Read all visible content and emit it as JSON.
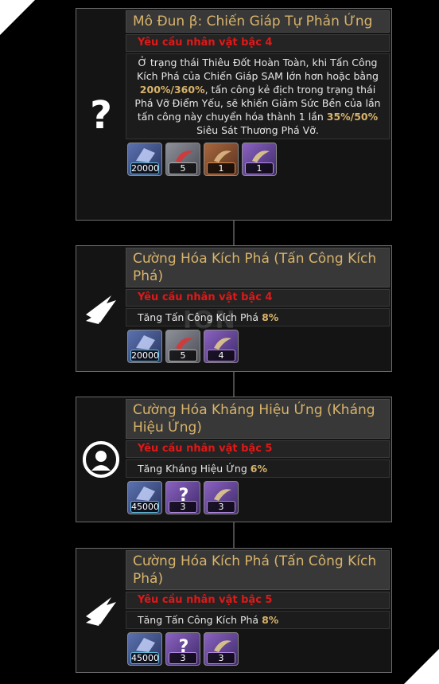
{
  "cards": [
    {
      "icon": "question-icon",
      "title": "Mô Đun β: Chiến Giáp Tự Phản Ứng",
      "requirement": "Yêu cầu nhân vật bậc 4",
      "desc_parts": [
        "Ở trạng thái Thiêu Đốt Hoàn Toàn, khi Tấn Công Kích Phá của Chiến Giáp SAM lớn hơn hoặc bằng ",
        "200%/360%",
        ", tấn công kẻ địch trong trạng thái Phá Vỡ Điểm Yếu, sẽ khiến Giảm Sức Bền của lần tấn công này chuyển hóa thành 1 lần ",
        "35%/50%",
        " Siêu Sát Thương Phá Vỡ."
      ],
      "items": [
        {
          "icon": "credit-crystal-icon",
          "qty": "20000",
          "rarity": "blue"
        },
        {
          "icon": "claw-material-icon",
          "qty": "5",
          "rarity": "gray"
        },
        {
          "icon": "claw-material-icon",
          "qty": "1",
          "rarity": "orange"
        },
        {
          "icon": "claw-material-icon",
          "qty": "1",
          "rarity": "purple"
        }
      ]
    },
    {
      "icon": "break-claw-icon",
      "title": "Cường Hóa Kích Phá (Tấn Công Kích Phá)",
      "requirement": "Yêu cầu nhân vật bậc 4",
      "desc_text": "Tăng Tấn Công Kích Phá ",
      "desc_value": "8%",
      "items": [
        {
          "icon": "credit-crystal-icon",
          "qty": "20000",
          "rarity": "blue"
        },
        {
          "icon": "claw-material-icon",
          "qty": "5",
          "rarity": "gray"
        },
        {
          "icon": "claw-material-icon",
          "qty": "4",
          "rarity": "purple"
        }
      ]
    },
    {
      "icon": "effect-resist-icon",
      "title": "Cường Hóa Kháng Hiệu Ứng (Kháng Hiệu Ứng)",
      "requirement": "Yêu cầu nhân vật bậc 5",
      "desc_text": "Tăng Kháng Hiệu Ứng ",
      "desc_value": "6%",
      "items": [
        {
          "icon": "credit-crystal-icon",
          "qty": "45000",
          "rarity": "blue"
        },
        {
          "icon": "question-icon",
          "qty": "3",
          "rarity": "purple"
        },
        {
          "icon": "claw-material-icon",
          "qty": "3",
          "rarity": "purple"
        }
      ]
    },
    {
      "icon": "break-claw-icon",
      "title": "Cường Hóa Kích Phá (Tấn Công Kích Phá)",
      "requirement": "Yêu cầu nhân vật bậc 5",
      "desc_text": "Tăng Tấn Công Kích Phá ",
      "desc_value": "8%",
      "items": [
        {
          "icon": "credit-crystal-icon",
          "qty": "45000",
          "rarity": "blue"
        },
        {
          "icon": "question-icon",
          "qty": "3",
          "rarity": "purple"
        },
        {
          "icon": "claw-material-icon",
          "qty": "3",
          "rarity": "purple"
        }
      ]
    }
  ],
  "watermark": "ION",
  "colors": {
    "title": "#d8b36a",
    "requirement": "#e01818",
    "highlight": "#d8b36a"
  }
}
